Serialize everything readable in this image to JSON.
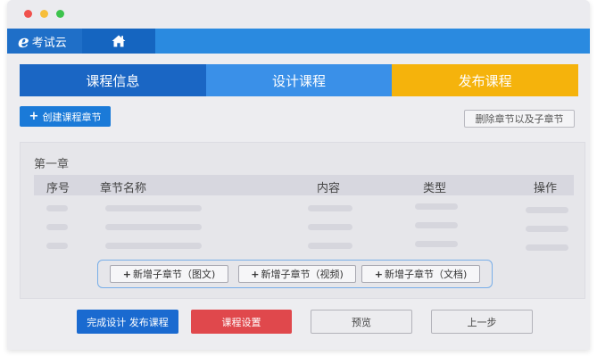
{
  "app": {
    "logo_letter": "e",
    "logo_text": "考试云"
  },
  "icons": {
    "home": "home-icon",
    "plus": "plus-icon"
  },
  "colors": {
    "appbar": "#2a8ae0",
    "step_1": "#1a66c4",
    "step_2": "#3a90e8",
    "step_3": "#f5b30c",
    "primary_button": "#1a6ad0",
    "danger_button": "#e0484c"
  },
  "steps": [
    {
      "label": "课程信息"
    },
    {
      "label": "设计课程",
      "active": true
    },
    {
      "label": "发布课程"
    }
  ],
  "toolbar": {
    "create_label": "创建课程章节",
    "delete_label": "删除章节以及子章节"
  },
  "chapter": {
    "title": "第一章",
    "columns": [
      "序号",
      "章节名称",
      "内容",
      "类型",
      "操作"
    ]
  },
  "add_buttons": [
    {
      "label": "新增子章节（图文)"
    },
    {
      "label": "新增子章节（视频)"
    },
    {
      "label": "新增子章节（文档)"
    }
  ],
  "footer": {
    "finish_label": "完成设计 发布课程",
    "settings_label": "课程设置",
    "preview_label": "预览",
    "prev_label": "上一步"
  }
}
